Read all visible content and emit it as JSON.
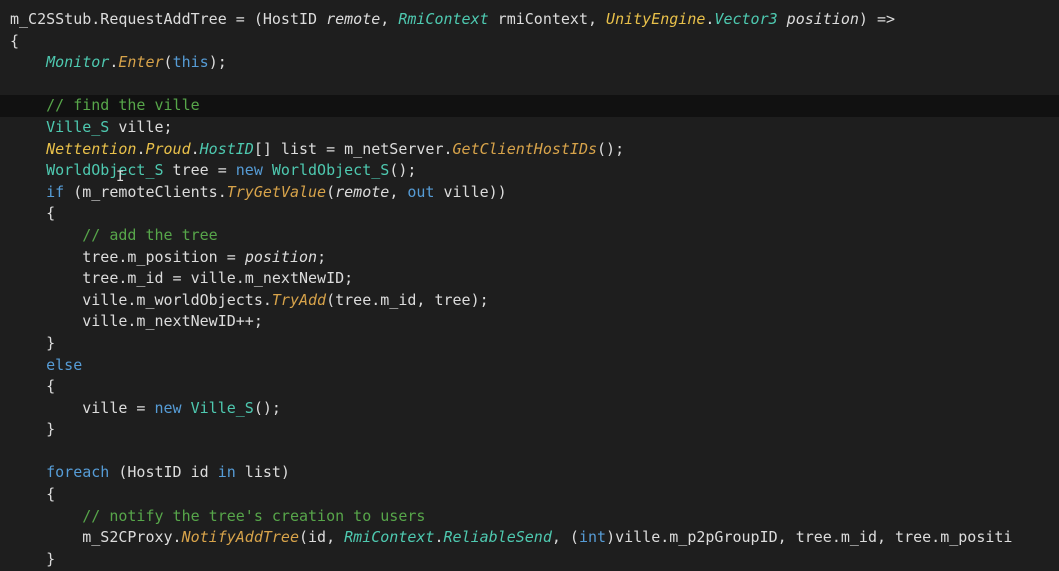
{
  "editor": {
    "lines": [
      [
        [
          "t-plain",
          "m_C2SStub.RequestAddTree = (HostID "
        ],
        [
          "t-param",
          "remote"
        ],
        [
          "t-plain",
          ", "
        ],
        [
          "t-type",
          "RmiContext"
        ],
        [
          "t-plain",
          " rmiContext, "
        ],
        [
          "t-class",
          "UnityEngine"
        ],
        [
          "t-plain",
          "."
        ],
        [
          "t-type",
          "Vector3"
        ],
        [
          "t-plain",
          " "
        ],
        [
          "t-param",
          "position"
        ],
        [
          "t-plain",
          ") =>"
        ]
      ],
      [
        [
          "t-plain",
          "{"
        ]
      ],
      [
        [
          "t-plain",
          "    "
        ],
        [
          "t-type",
          "Monitor"
        ],
        [
          "t-plain",
          "."
        ],
        [
          "t-method",
          "Enter"
        ],
        [
          "t-plain",
          "("
        ],
        [
          "t-kw",
          "this"
        ],
        [
          "t-plain",
          ");"
        ]
      ],
      [
        [
          "t-plain",
          ""
        ]
      ],
      [
        [
          "t-plain",
          "    "
        ],
        [
          "t-comment",
          "// find the ville"
        ]
      ],
      [
        [
          "t-plain",
          "    "
        ],
        [
          "t-typeb",
          "Ville_S"
        ],
        [
          "t-plain",
          " ville;"
        ]
      ],
      [
        [
          "t-plain",
          "    "
        ],
        [
          "t-class",
          "Nettention"
        ],
        [
          "t-plain",
          "."
        ],
        [
          "t-class",
          "Proud"
        ],
        [
          "t-plain",
          "."
        ],
        [
          "t-type",
          "HostID"
        ],
        [
          "t-plain",
          "[] list = m_netServer."
        ],
        [
          "t-method",
          "GetClientHostIDs"
        ],
        [
          "t-plain",
          "();"
        ]
      ],
      [
        [
          "t-plain",
          "    "
        ],
        [
          "t-typeb",
          "WorldObject_S"
        ],
        [
          "t-plain",
          " tree = "
        ],
        [
          "t-kw",
          "new"
        ],
        [
          "t-plain",
          " "
        ],
        [
          "t-typeb",
          "WorldObject_S"
        ],
        [
          "t-plain",
          "();"
        ]
      ],
      [
        [
          "t-plain",
          "    "
        ],
        [
          "t-kw",
          "if"
        ],
        [
          "t-plain",
          " (m_remoteClients."
        ],
        [
          "t-method",
          "TryGetValue"
        ],
        [
          "t-plain",
          "("
        ],
        [
          "t-param",
          "remote"
        ],
        [
          "t-plain",
          ", "
        ],
        [
          "t-kw",
          "out"
        ],
        [
          "t-plain",
          " ville))"
        ]
      ],
      [
        [
          "t-plain",
          "    {"
        ]
      ],
      [
        [
          "t-plain",
          "        "
        ],
        [
          "t-comment",
          "// add the tree"
        ]
      ],
      [
        [
          "t-plain",
          "        tree.m_position = "
        ],
        [
          "t-param",
          "position"
        ],
        [
          "t-plain",
          ";"
        ]
      ],
      [
        [
          "t-plain",
          "        tree.m_id = ville.m_nextNewID;"
        ]
      ],
      [
        [
          "t-plain",
          "        ville.m_worldObjects."
        ],
        [
          "t-method",
          "TryAdd"
        ],
        [
          "t-plain",
          "(tree.m_id, tree);"
        ]
      ],
      [
        [
          "t-plain",
          "        ville.m_nextNewID++;"
        ]
      ],
      [
        [
          "t-plain",
          "    }"
        ]
      ],
      [
        [
          "t-plain",
          "    "
        ],
        [
          "t-kw",
          "else"
        ]
      ],
      [
        [
          "t-plain",
          "    {"
        ]
      ],
      [
        [
          "t-plain",
          "        ville = "
        ],
        [
          "t-kw",
          "new"
        ],
        [
          "t-plain",
          " "
        ],
        [
          "t-typeb",
          "Ville_S"
        ],
        [
          "t-plain",
          "();"
        ]
      ],
      [
        [
          "t-plain",
          "    }"
        ]
      ],
      [
        [
          "t-plain",
          ""
        ]
      ],
      [
        [
          "t-plain",
          "    "
        ],
        [
          "t-kw",
          "foreach"
        ],
        [
          "t-plain",
          " (HostID id "
        ],
        [
          "t-kw",
          "in"
        ],
        [
          "t-plain",
          " list)"
        ]
      ],
      [
        [
          "t-plain",
          "    {"
        ]
      ],
      [
        [
          "t-plain",
          "        "
        ],
        [
          "t-comment",
          "// notify the tree's creation to users"
        ]
      ],
      [
        [
          "t-plain",
          "        m_S2CProxy."
        ],
        [
          "t-method",
          "NotifyAddTree"
        ],
        [
          "t-plain",
          "(id, "
        ],
        [
          "t-type",
          "RmiContext"
        ],
        [
          "t-plain",
          "."
        ],
        [
          "t-type",
          "ReliableSend"
        ],
        [
          "t-plain",
          ", ("
        ],
        [
          "t-kw",
          "int"
        ],
        [
          "t-plain",
          ")ville.m_p2pGroupID, tree.m_id, tree.m_positi"
        ]
      ],
      [
        [
          "t-plain",
          "    }"
        ]
      ]
    ],
    "current_line": 4
  }
}
